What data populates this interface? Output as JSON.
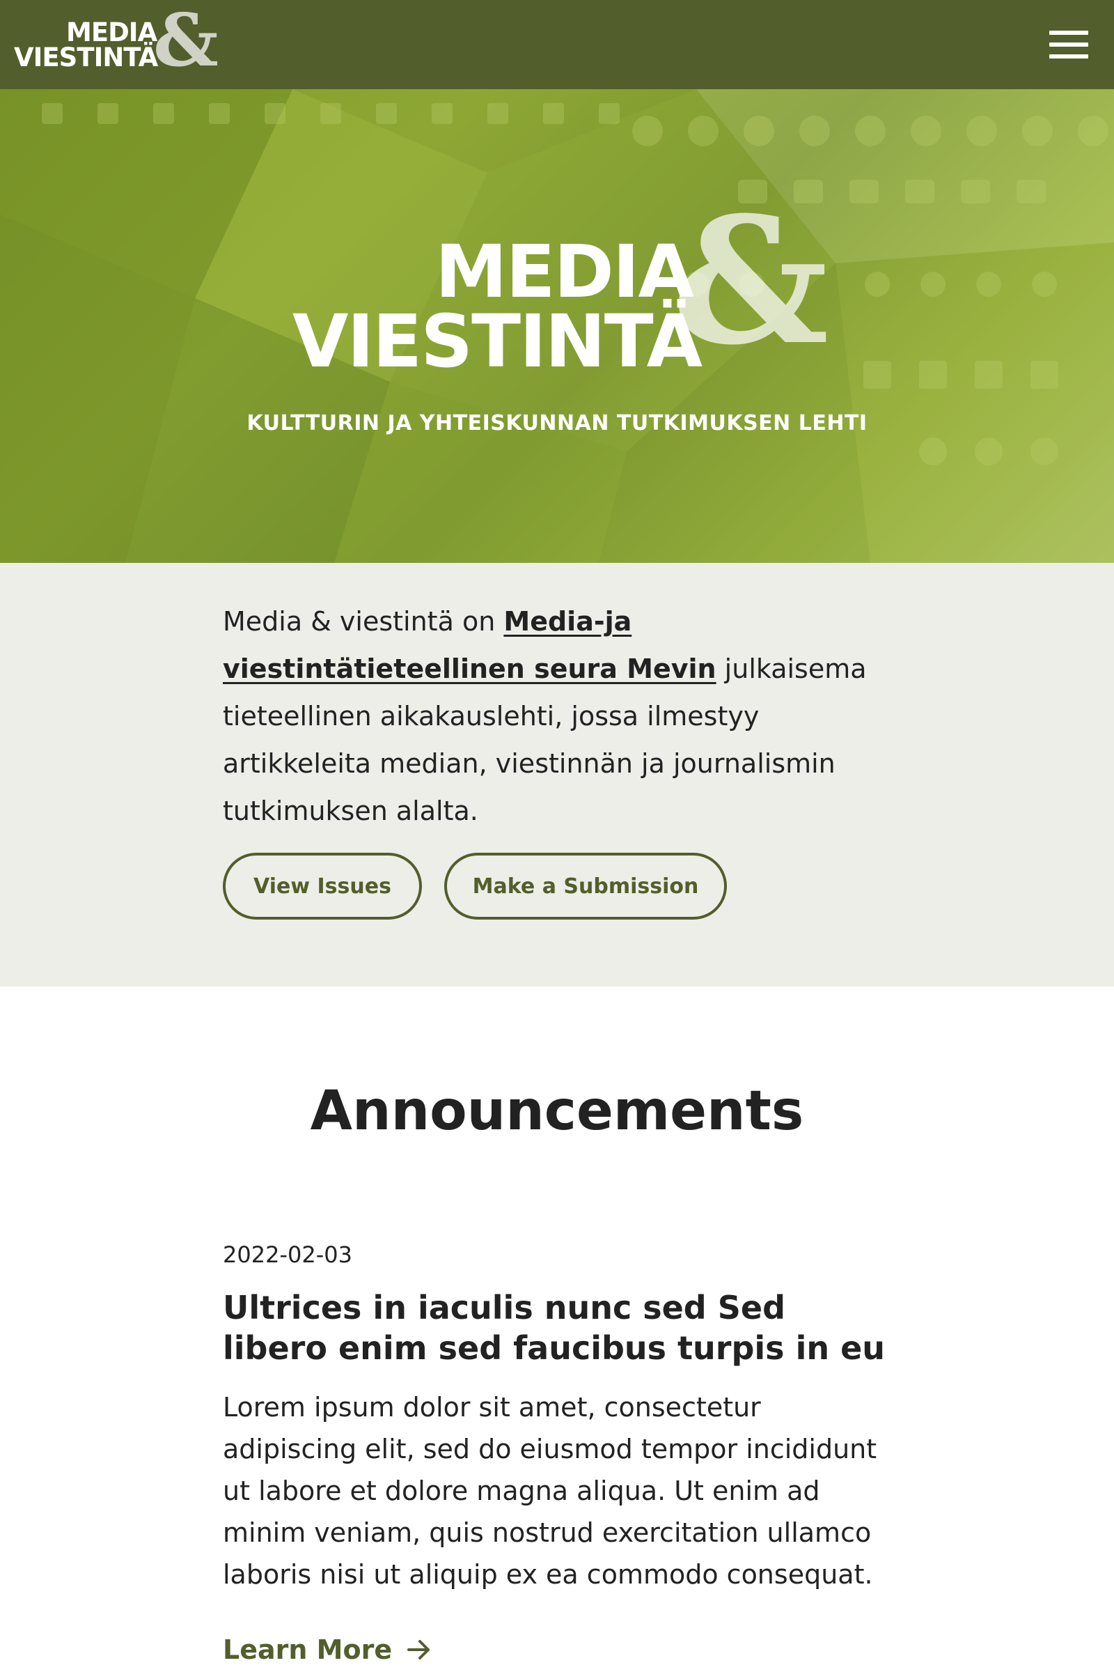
{
  "header": {
    "logo_word1": "MEDIA",
    "logo_word2": "VIESTINTÄ",
    "logo_amp": "&",
    "menu_icon": "hamburger-menu-icon",
    "background_color": "#525e2c"
  },
  "hero": {
    "logo_word1": "MEDIA",
    "logo_word2": "VIESTINTÄ",
    "logo_amp": "&",
    "tagline": "KULTTURIN JA YHTEISKUNNAN TUTKIMUKSEN LEHTI"
  },
  "about": {
    "text_before_link": "Media & viestintä on ",
    "link_text": "Media-ja viestintätieteellinen seura Mevin",
    "text_after_link": " julkaisema tieteellinen aikakauslehti, jossa ilmestyy artikkeleita median, viestinnän ja journalismin tutkimuksen alalta.",
    "background_color": "#edeee8"
  },
  "actions": {
    "view_issues": "View Issues",
    "make_submission": "Make a Submission"
  },
  "announcements": {
    "title": "Announcements",
    "items": [
      {
        "date": "2022-02-03",
        "heading": "Ultrices in iaculis nunc sed Sed libero enim sed faucibus turpis in eu",
        "body": "Lorem ipsum dolor sit amet, consectetur adipiscing elit, sed do eiusmod tempor incididunt ut labore et dolore magna aliqua. Ut enim ad minim veniam, quis nostrud exercitation ullamco laboris nisi ut aliquip ex ea commodo consequat.",
        "link_label": "Learn More"
      }
    ]
  },
  "colors": {
    "accent": "#525e2c",
    "hero_green": "#8ea734",
    "text": "#222222"
  }
}
